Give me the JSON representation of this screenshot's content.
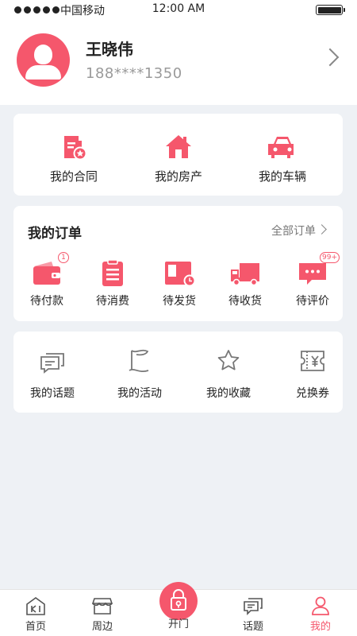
{
  "status_bar": {
    "carrier": "中国移动",
    "time": "12:00 AM"
  },
  "profile": {
    "name": "王晓伟",
    "phone": "188****1350"
  },
  "assets": [
    {
      "label": "我的合同",
      "icon": "contract-icon"
    },
    {
      "label": "我的房产",
      "icon": "house-icon"
    },
    {
      "label": "我的车辆",
      "icon": "car-icon"
    }
  ],
  "orders": {
    "title": "我的订单",
    "all_label": "全部订单",
    "items": [
      {
        "label": "待付款",
        "icon": "wallet-icon",
        "badge": "1"
      },
      {
        "label": "待消费",
        "icon": "clipboard-icon",
        "badge": ""
      },
      {
        "label": "待发货",
        "icon": "package-icon",
        "badge": ""
      },
      {
        "label": "待收货",
        "icon": "truck-icon",
        "badge": ""
      },
      {
        "label": "待评价",
        "icon": "comment-icon",
        "badge": "99+"
      }
    ]
  },
  "services": [
    {
      "label": "我的话题",
      "icon": "chat-icon"
    },
    {
      "label": "我的活动",
      "icon": "flag-icon"
    },
    {
      "label": "我的收藏",
      "icon": "star-icon"
    },
    {
      "label": "兑换券",
      "icon": "coupon-icon"
    }
  ],
  "nav": {
    "home": "首页",
    "nearby": "周边",
    "open": "开门",
    "topics": "话题",
    "mine": "我的"
  },
  "colors": {
    "accent": "#f5576c",
    "background": "#eef1f5"
  }
}
